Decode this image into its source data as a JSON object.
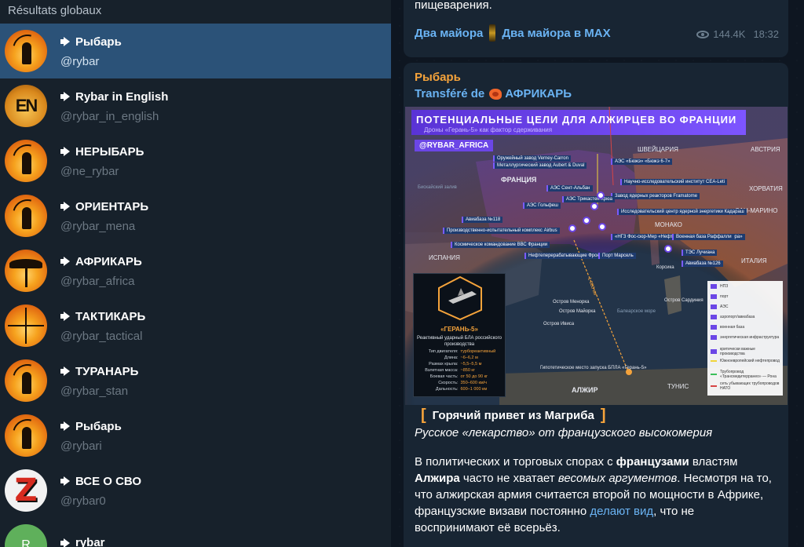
{
  "search": {
    "section_title": "Résultats globaux"
  },
  "results": [
    {
      "title": "Рыбарь",
      "handle": "@rybar",
      "active": true
    },
    {
      "title": "Rybar in English",
      "handle": "@rybar_in_english",
      "avatar_text": "EN"
    },
    {
      "title": "НЕРЫБАРЬ",
      "handle": "@ne_rybar"
    },
    {
      "title": "ОРИЕНТАРЬ",
      "handle": "@rybar_mena"
    },
    {
      "title": "АФРИКАРЬ",
      "handle": "@rybar_africa"
    },
    {
      "title": "ТАКТИКАРЬ",
      "handle": "@rybar_tactical"
    },
    {
      "title": "ТУРАНАРЬ",
      "handle": "@rybar_stan"
    },
    {
      "title": "Рыбарь",
      "handle": "@rybari"
    },
    {
      "title": "ВСЕ О СВО",
      "handle": "@rybar0",
      "avatar_text": "Z"
    },
    {
      "title": "rybar",
      "handle": "",
      "avatar_text": "R"
    }
  ],
  "prev_message": {
    "text_tail": "пищеварения.",
    "link_left": "Два майора",
    "link_right": "Два майора в MAX",
    "views": "144.4K",
    "time": "18:32"
  },
  "post": {
    "author": "Рыбарь",
    "forwarded_prefix": "Transféré de",
    "forwarded_from": "АФРИКАРЬ",
    "map": {
      "title": "ПОТЕНЦИАЛЬНЫЕ ЦЕЛИ ДЛЯ АЛЖИРЦЕВ ВО ФРАНЦИИ",
      "subtitle": "Дроны «Герань-5» как фактор сдерживания",
      "channel_tag": "@RYBAR_AFRICA",
      "countries": {
        "france": "ФРАНЦИЯ",
        "switzerland": "ШВЕЙЦАРИЯ",
        "austria": "АВСТРИЯ",
        "croatia": "ХОРВАТИЯ",
        "san_marino": "САН-МАРИНО",
        "monaco": "МОНАКО",
        "spain": "ИСПАНИЯ",
        "italy": "ИТАЛИЯ",
        "algeria": "АЛЖИР",
        "tunisia": "ТУНИС",
        "biscay": "Бискайский залив",
        "balearic": "Балеарское море"
      },
      "targets": [
        "Оружейный завод Verney-Carron",
        "Металлургический завод Aubert & Duval",
        "АЭС Сент-Альбан",
        "АЭС «Бюжэ» «Бюжэ 6-7»",
        "Научно-исследовательский институт CEA-Leti",
        "Завод ядерных реакторов Framatome",
        "АЭС Трикастен Крюа",
        "АЭС Гольфеш",
        "Исследовательский центр ядерной энергетики Кадараш",
        "Авиабаза №118",
        "Производственно-испытательный комплекс Airbus",
        "Космическое командование ВВС Франции",
        "«НГЗ Фос-сюр-Мер «Нефтехимический комплекс Лавера»",
        "Нефтеперерабатывающие Фронтиньян",
        "Порт Марсель",
        "Военная база Раффалли",
        "ТЭС Лучиана",
        "Авиабаза №126"
      ],
      "islands": {
        "minorca": "Остров Менорка",
        "majorca": "Остров Майорка",
        "ibiza": "Остров Ивиса",
        "sardinia": "Остров Сардиния",
        "corsica": "Корсика"
      },
      "launch_site": "Гипотетическое место запуска БПЛА «Герань-5»",
      "distance": "1 000 км",
      "drone_card": {
        "title": "«ГЕРАНЬ-5»",
        "description": "Реактивный ударный БЛА российского производства",
        "specs": [
          {
            "k": "Тип двигателя:",
            "v": "турбореактивный"
          },
          {
            "k": "Длина:",
            "v": "~6–6,2 м"
          },
          {
            "k": "Размах крыла:",
            "v": "~5,5–5,5 м"
          },
          {
            "k": "Взлетная масса:",
            "v": "~850 кг"
          },
          {
            "k": "Боевая часть:",
            "v": "от 50 до 90 кг"
          },
          {
            "k": "Скорость:",
            "v": "350–600 км/ч"
          },
          {
            "k": "Дальность:",
            "v": "600–1 000 км"
          }
        ]
      },
      "legend": [
        {
          "label": "НПЗ",
          "color": "#6b46e6"
        },
        {
          "label": "порт",
          "color": "#6b46e6"
        },
        {
          "label": "АЭС",
          "color": "#6b46e6"
        },
        {
          "label": "аэропорт/авиабаза",
          "color": "#6b46e6"
        },
        {
          "label": "военная база",
          "color": "#6b46e6"
        },
        {
          "label": "энергетическая инфраструктура",
          "color": "#6b46e6"
        },
        {
          "label": "критически важные производства",
          "color": "#6b46e6"
        },
        {
          "label": "Южноевропейский нефтепровод",
          "color": "#f0d43a"
        },
        {
          "label": "Трубопровод «Трансмедитерранео» — Рона",
          "color": "#3bbf5a"
        },
        {
          "label": "сеть убывающих трубопроводов НАТО",
          "color": "#d64545"
        }
      ]
    },
    "heading": "Горячий привет из Магриба",
    "subheading": "Русское «лекарство» от французского высокомерия",
    "body": {
      "p1": "В политических и торговых спорах с ",
      "b1": "французами",
      "p2": " властям ",
      "b2": "Алжира",
      "p3": " часто не хватает ",
      "i1": "весомых аргументов",
      "p4": ". Несмотря на то, что алжирская армия считается второй по мощности в Африке, французские визави постоянно ",
      "link": "делают вид",
      "p5": ", что не воспринимают её всерьёз."
    }
  },
  "colors": {
    "accent": "#6ab3f3",
    "author": "#f5a33b",
    "active_item": "#2b5278"
  }
}
